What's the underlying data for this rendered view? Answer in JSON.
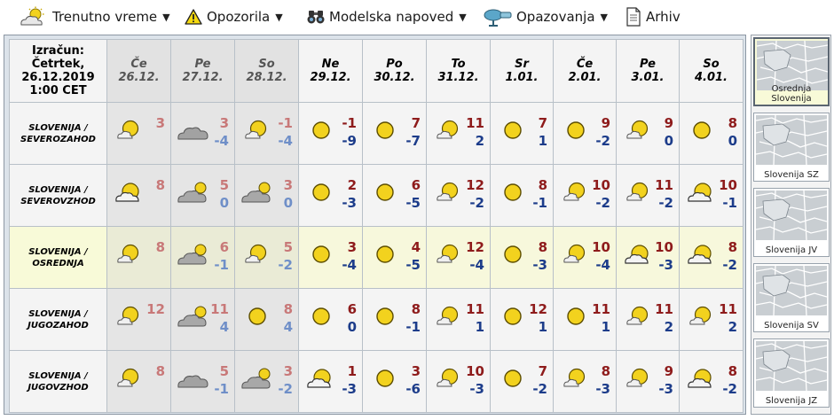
{
  "menu": [
    {
      "label": "Trenutno vreme",
      "icon": "sun-cloud-icon",
      "has_dropdown": true
    },
    {
      "label": "Opozorila",
      "icon": "warning-icon",
      "has_dropdown": true
    },
    {
      "label": "Modelska napoved",
      "icon": "binoculars-icon",
      "has_dropdown": true
    },
    {
      "label": "Opazovanja",
      "icon": "observation-icon",
      "has_dropdown": true
    },
    {
      "label": "Arhiv",
      "icon": "document-icon",
      "has_dropdown": false
    }
  ],
  "table": {
    "header_corner": [
      "Izračun:",
      "Četrtek,",
      "26.12.2019",
      "1:00 CET"
    ],
    "days": [
      {
        "name": "Če",
        "date": "26.12.",
        "past": true
      },
      {
        "name": "Pe",
        "date": "27.12.",
        "past": true
      },
      {
        "name": "So",
        "date": "28.12.",
        "past": true
      },
      {
        "name": "Ne",
        "date": "29.12.",
        "past": false
      },
      {
        "name": "Po",
        "date": "30.12.",
        "past": false
      },
      {
        "name": "To",
        "date": "31.12.",
        "past": false
      },
      {
        "name": "Sr",
        "date": "1.01.",
        "past": false
      },
      {
        "name": "Če",
        "date": "2.01.",
        "past": false
      },
      {
        "name": "Pe",
        "date": "3.01.",
        "past": false
      },
      {
        "name": "So",
        "date": "4.01.",
        "past": false
      }
    ],
    "rows": [
      {
        "region": [
          "SLOVENIJA /",
          "SEVEROZAHOD"
        ],
        "highlight": false,
        "cells": [
          {
            "icon": "partly-cloudy-icon",
            "max": "3",
            "min": ""
          },
          {
            "icon": "cloudy-icon",
            "max": "3",
            "min": "-4"
          },
          {
            "icon": "partly-cloudy-icon",
            "max": "-1",
            "min": "-4"
          },
          {
            "icon": "sunny-icon",
            "max": "-1",
            "min": "-9"
          },
          {
            "icon": "sunny-icon",
            "max": "7",
            "min": "-7"
          },
          {
            "icon": "partly-cloudy-icon",
            "max": "11",
            "min": "2"
          },
          {
            "icon": "sunny-icon",
            "max": "7",
            "min": "1"
          },
          {
            "icon": "sunny-icon",
            "max": "9",
            "min": "-2"
          },
          {
            "icon": "partly-cloudy-icon",
            "max": "9",
            "min": "0"
          },
          {
            "icon": "sunny-icon",
            "max": "8",
            "min": "0"
          }
        ]
      },
      {
        "region": [
          "SLOVENIJA /",
          "SEVEROVZHOD"
        ],
        "highlight": false,
        "cells": [
          {
            "icon": "sun-behind-cloud-icon",
            "max": "8",
            "min": ""
          },
          {
            "icon": "cloud-sun-icon",
            "max": "5",
            "min": "0"
          },
          {
            "icon": "cloud-sun-icon",
            "max": "3",
            "min": "0"
          },
          {
            "icon": "sunny-icon",
            "max": "2",
            "min": "-3"
          },
          {
            "icon": "sunny-icon",
            "max": "6",
            "min": "-5"
          },
          {
            "icon": "partly-cloudy-icon",
            "max": "12",
            "min": "-2"
          },
          {
            "icon": "sunny-icon",
            "max": "8",
            "min": "-1"
          },
          {
            "icon": "partly-cloudy-icon",
            "max": "10",
            "min": "-2"
          },
          {
            "icon": "partly-cloudy-icon",
            "max": "11",
            "min": "-2"
          },
          {
            "icon": "sun-behind-cloud-icon",
            "max": "10",
            "min": "-1"
          }
        ]
      },
      {
        "region": [
          "SLOVENIJA /",
          "OSREDNJA"
        ],
        "highlight": true,
        "cells": [
          {
            "icon": "partly-cloudy-icon",
            "max": "8",
            "min": ""
          },
          {
            "icon": "cloud-sun-icon",
            "max": "6",
            "min": "-1"
          },
          {
            "icon": "partly-cloudy-icon",
            "max": "5",
            "min": "-2"
          },
          {
            "icon": "sunny-icon",
            "max": "3",
            "min": "-4"
          },
          {
            "icon": "sunny-icon",
            "max": "4",
            "min": "-5"
          },
          {
            "icon": "partly-cloudy-icon",
            "max": "12",
            "min": "-4"
          },
          {
            "icon": "sunny-icon",
            "max": "8",
            "min": "-3"
          },
          {
            "icon": "partly-cloudy-icon",
            "max": "10",
            "min": "-4"
          },
          {
            "icon": "sun-behind-cloud-icon",
            "max": "10",
            "min": "-3"
          },
          {
            "icon": "sun-behind-cloud-icon",
            "max": "8",
            "min": "-2"
          }
        ]
      },
      {
        "region": [
          "SLOVENIJA /",
          "JUGOZAHOD"
        ],
        "highlight": false,
        "cells": [
          {
            "icon": "partly-cloudy-icon",
            "max": "12",
            "min": ""
          },
          {
            "icon": "cloud-sun-icon",
            "max": "11",
            "min": "4"
          },
          {
            "icon": "sunny-icon",
            "max": "8",
            "min": "4"
          },
          {
            "icon": "sunny-icon",
            "max": "6",
            "min": "0"
          },
          {
            "icon": "sunny-icon",
            "max": "8",
            "min": "-1"
          },
          {
            "icon": "partly-cloudy-icon",
            "max": "11",
            "min": "1"
          },
          {
            "icon": "sunny-icon",
            "max": "12",
            "min": "1"
          },
          {
            "icon": "sunny-icon",
            "max": "11",
            "min": "1"
          },
          {
            "icon": "partly-cloudy-icon",
            "max": "11",
            "min": "2"
          },
          {
            "icon": "partly-cloudy-icon",
            "max": "11",
            "min": "2"
          }
        ]
      },
      {
        "region": [
          "SLOVENIJA /",
          "JUGOVZHOD"
        ],
        "highlight": false,
        "cells": [
          {
            "icon": "partly-cloudy-icon",
            "max": "8",
            "min": ""
          },
          {
            "icon": "cloudy-icon",
            "max": "5",
            "min": "-1"
          },
          {
            "icon": "cloud-sun-icon",
            "max": "3",
            "min": "-2"
          },
          {
            "icon": "sun-behind-cloud-icon",
            "max": "1",
            "min": "-3"
          },
          {
            "icon": "sunny-icon",
            "max": "3",
            "min": "-6"
          },
          {
            "icon": "partly-cloudy-icon",
            "max": "10",
            "min": "-3"
          },
          {
            "icon": "sunny-icon",
            "max": "7",
            "min": "-2"
          },
          {
            "icon": "partly-cloudy-icon",
            "max": "8",
            "min": "-3"
          },
          {
            "icon": "partly-cloudy-icon",
            "max": "9",
            "min": "-3"
          },
          {
            "icon": "sun-behind-cloud-icon",
            "max": "8",
            "min": "-2"
          }
        ]
      }
    ]
  },
  "maps": [
    {
      "label": "Osrednja Slovenija",
      "selected": true
    },
    {
      "label": "Slovenija SZ",
      "selected": false
    },
    {
      "label": "Slovenija JV",
      "selected": false
    },
    {
      "label": "Slovenija SV",
      "selected": false
    },
    {
      "label": "Slovenija JZ",
      "selected": false
    }
  ],
  "colors": {
    "past_max": "#c87878",
    "past_min": "#6f8fc8",
    "future_max": "#8e1b1b",
    "future_min": "#1c3c8a",
    "highlight_row": "#f7f8dc",
    "sun": "#f2d21e",
    "cloud": "#9a9a9a"
  }
}
